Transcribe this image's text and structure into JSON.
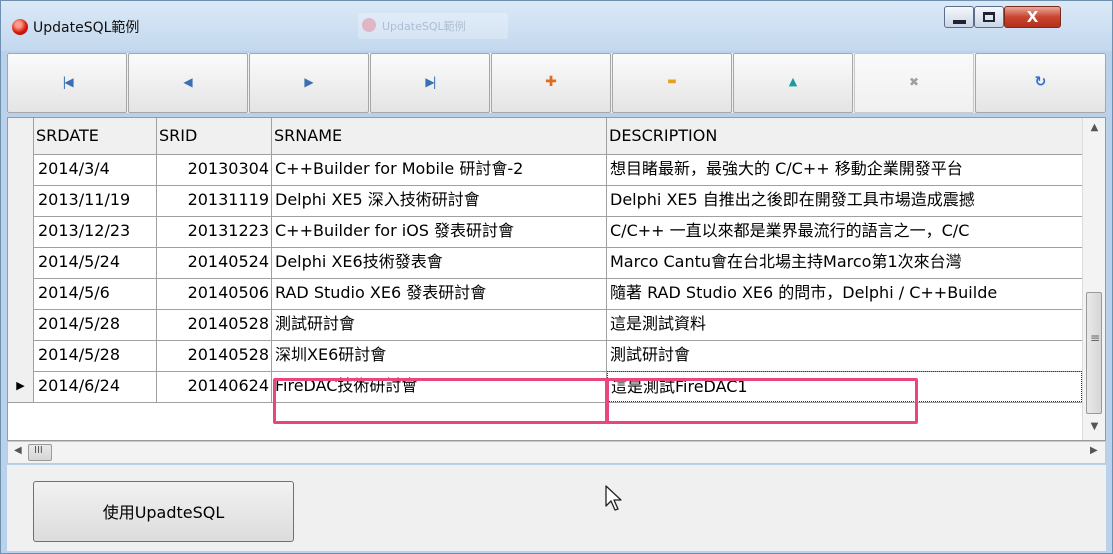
{
  "window": {
    "title": "UpdateSQL範例",
    "ghost_title": "UpdateSQL範例",
    "close_glyph": "X"
  },
  "navigator": {
    "buttons": [
      {
        "name": "first",
        "glyph": "|◀",
        "color": "#3a6fb5"
      },
      {
        "name": "prior",
        "glyph": "◀",
        "color": "#3a6fb5"
      },
      {
        "name": "next",
        "glyph": "▶",
        "color": "#3a6fb5"
      },
      {
        "name": "last",
        "glyph": "▶|",
        "color": "#3a6fb5"
      },
      {
        "name": "insert",
        "glyph": "✚",
        "color": "#e46b1b"
      },
      {
        "name": "delete",
        "glyph": "▬",
        "color": "#e4a21b"
      },
      {
        "name": "post",
        "glyph": "▲",
        "color": "#1b9c9c"
      },
      {
        "name": "cancel",
        "glyph": "✖",
        "color": "#a0a0a0"
      },
      {
        "name": "refresh",
        "glyph": "↻",
        "color": "#2a6fd1"
      }
    ]
  },
  "grid": {
    "columns": [
      "SRDATE",
      "SRID",
      "SRNAME",
      "DESCRIPTION"
    ],
    "rows": [
      {
        "srdate": "2014/3/4",
        "srid": "20130304",
        "srname": "C++Builder for Mobile 研討會-2",
        "description": "想目睹最新，最強大的 C/C++ 移動企業開發平台"
      },
      {
        "srdate": "2013/11/19",
        "srid": "20131119",
        "srname": "Delphi XE5 深入技術研討會",
        "description": "Delphi XE5 自推出之後即在開發工具市場造成震撼"
      },
      {
        "srdate": "2013/12/23",
        "srid": "20131223",
        "srname": "C++Builder for iOS 發表研討會",
        "description": "C/C++ 一直以來都是業界最流行的語言之一，C/C"
      },
      {
        "srdate": "2014/5/24",
        "srid": "20140524",
        "srname": "Delphi XE6技術發表會",
        "description": "Marco Cantu會在台北場主持Marco第1次來台灣"
      },
      {
        "srdate": "2014/5/6",
        "srid": "20140506",
        "srname": "RAD Studio XE6 發表研討會",
        "description": "隨著 RAD Studio XE6 的問市，Delphi / C++Builde"
      },
      {
        "srdate": "2014/5/28",
        "srid": "20140528",
        "srname": "測試研討會",
        "description": "這是測試資料"
      },
      {
        "srdate": "2014/5/28",
        "srid": "20140528",
        "srname": "深圳XE6研討會",
        "description": "測試研討會"
      },
      {
        "srdate": "2014/6/24",
        "srid": "20140624",
        "srname": "FireDAC技術研討會",
        "description": "這是測試FireDAC1"
      }
    ],
    "current_row_indicator": "▶",
    "hscroll_grip": "III",
    "vscroll_grip": "≡"
  },
  "actions": {
    "use_updatesql_label": "使用UpadteSQL"
  },
  "annotation": {
    "highlight_color": "#e8467c"
  }
}
